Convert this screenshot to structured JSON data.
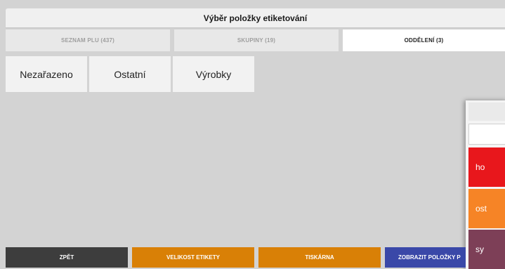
{
  "header": {
    "title": "Výběr položky etiketování"
  },
  "tabs": [
    {
      "label": "SEZNAM PLU (437)",
      "active": false
    },
    {
      "label": "SKUPINY (19)",
      "active": false
    },
    {
      "label": "ODDĚLENÍ (3)",
      "active": true
    }
  ],
  "categories": [
    {
      "label": "Nezařazeno"
    },
    {
      "label": "Ostatní"
    },
    {
      "label": "Výrobky"
    }
  ],
  "side_panel": {
    "items": [
      {
        "label": "ho",
        "color": "#e8171c"
      },
      {
        "label": "ost",
        "color": "#f68426"
      },
      {
        "label": "sy",
        "color": "#7d3f57"
      }
    ]
  },
  "bottom_bar": {
    "back": "ZPĚT",
    "label_size": "VELIKOST ETIKETY",
    "printer": "TISKÁRNA",
    "show_items": "ZOBRAZIT POLOŽKY P"
  },
  "colors": {
    "back": "#3d3d3d",
    "orange": "#d98006",
    "blue": "#3a48a8"
  }
}
